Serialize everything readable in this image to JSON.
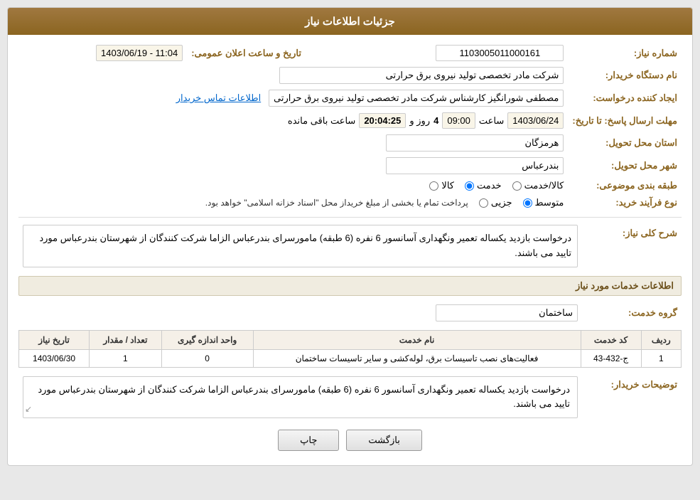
{
  "header": {
    "title": "جزئیات اطلاعات نیاز"
  },
  "fields": {
    "need_number_label": "شماره نیاز:",
    "need_number_value": "1103005011000161",
    "requester_label": "نام دستگاه خریدار:",
    "requester_value": "شرکت مادر تخصصی تولید نیروی برق حرارتی",
    "creator_label": "ایجاد کننده درخواست:",
    "creator_value": "مصطفی شورانگیز کارشناس شرکت مادر تخصصی تولید نیروی برق حرارتی",
    "contact_link": "اطلاعات تماس خریدار",
    "deadline_label": "مهلت ارسال پاسخ: تا تاریخ:",
    "deadline_date": "1403/06/24",
    "deadline_time_label": "ساعت",
    "deadline_time": "09:00",
    "deadline_days_label": "روز و",
    "deadline_days": "4",
    "deadline_remaining_label": "ساعت باقی مانده",
    "deadline_remaining": "20:04:25",
    "province_label": "استان محل تحویل:",
    "province_value": "هرمزگان",
    "city_label": "شهر محل تحویل:",
    "city_value": "بندرعباس",
    "category_label": "طبقه بندی موضوعی:",
    "category_options": [
      "کالا",
      "خدمت",
      "کالا/خدمت"
    ],
    "category_selected": "خدمت",
    "purchase_type_label": "نوع فرآیند خرید:",
    "purchase_type_options": [
      "جزیی",
      "متوسط"
    ],
    "purchase_type_selected": "متوسط",
    "purchase_type_note": "پرداخت تمام یا بخشی از مبلغ خریداز محل \"اسناد خزانه اسلامی\" خواهد بود.",
    "announcement_label": "تاریخ و ساعت اعلان عمومی:",
    "announcement_value": "1403/06/19 - 11:04",
    "general_desc_label": "شرح کلی نیاز:",
    "general_desc": "درخواست بازدید یکساله تعمیر ونگهداری آسانسور 6 نفره (6 طبقه) مامورسرای بندرعباس الزاما شرکت کنندگان از شهرستان بندرعباس مورد تایید می باشند.",
    "services_section_title": "اطلاعات خدمات مورد نیاز",
    "service_group_label": "گروه خدمت:",
    "service_group_value": "ساختمان",
    "table": {
      "headers": [
        "ردیف",
        "کد خدمت",
        "نام خدمت",
        "واحد اندازه گیری",
        "تعداد / مقدار",
        "تاریخ نیاز"
      ],
      "rows": [
        {
          "row": "1",
          "code": "ج-432-43",
          "name": "فعالیت‌های نصب تاسیسات برق، لوله‌کشی و سایر تاسیسات ساختمان",
          "unit": "0",
          "quantity": "1",
          "date": "1403/06/30"
        }
      ]
    },
    "buyer_desc_label": "توضیحات خریدار:",
    "buyer_desc": "درخواست بازدید یکساله تعمیر ونگهداری آسانسور 6 نفره (6 طبقه) مامورسرای بندرعباس الزاما شرکت کنندگان از شهرستان بندرعباس مورد تایید می باشند."
  },
  "buttons": {
    "print": "چاپ",
    "back": "بازگشت"
  }
}
